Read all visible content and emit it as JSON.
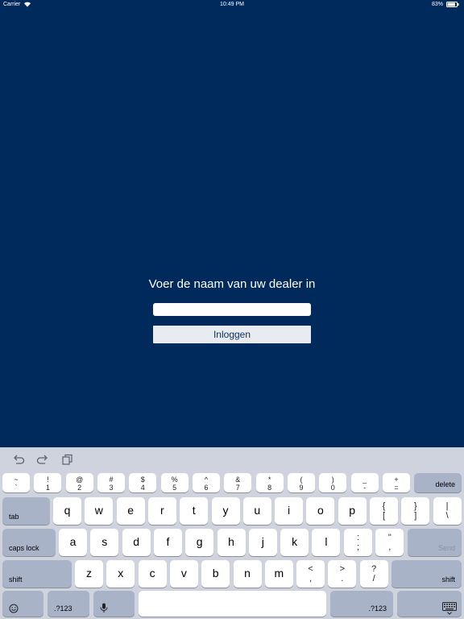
{
  "status_bar": {
    "carrier": "Carrier",
    "time": "10:49 PM",
    "battery": "83%"
  },
  "login": {
    "prompt": "Voer de naam van uw dealer in",
    "input_value": "",
    "button_label": "Inloggen"
  },
  "keyboard": {
    "number_row": [
      {
        "up": "~",
        "dn": "`"
      },
      {
        "up": "!",
        "dn": "1"
      },
      {
        "up": "@",
        "dn": "2"
      },
      {
        "up": "#",
        "dn": "3"
      },
      {
        "up": "$",
        "dn": "4"
      },
      {
        "up": "%",
        "dn": "5"
      },
      {
        "up": "^",
        "dn": "6"
      },
      {
        "up": "&",
        "dn": "7"
      },
      {
        "up": "*",
        "dn": "8"
      },
      {
        "up": "(",
        "dn": "9"
      },
      {
        "up": ")",
        "dn": "0"
      },
      {
        "up": "_",
        "dn": "-"
      },
      {
        "up": "+",
        "dn": "="
      }
    ],
    "delete": "delete",
    "tab": "tab",
    "row1": [
      "q",
      "w",
      "e",
      "r",
      "t",
      "y",
      "u",
      "i",
      "o",
      "p"
    ],
    "row1_sym": [
      {
        "up": "{",
        "dn": "["
      },
      {
        "up": "}",
        "dn": "]"
      },
      {
        "up": "|",
        "dn": "\\"
      }
    ],
    "caps_lock": "caps lock",
    "row2": [
      "a",
      "s",
      "d",
      "f",
      "g",
      "h",
      "j",
      "k",
      "l"
    ],
    "row2_sym": [
      {
        "up": ":",
        "dn": ";"
      },
      {
        "up": "\"",
        "dn": ","
      }
    ],
    "send": "Send",
    "shift_left": "shift",
    "row3": [
      "z",
      "x",
      "c",
      "v",
      "b",
      "n",
      "m"
    ],
    "row3_sym": [
      {
        "up": "<",
        "dn": ","
      },
      {
        "up": ">",
        "dn": "."
      },
      {
        "up": "?",
        "dn": "/"
      }
    ],
    "shift_right": "shift",
    "num_toggle_left": ".?123",
    "num_toggle_right": ".?123",
    "icons": {
      "undo": "undo-icon",
      "redo": "redo-icon",
      "paste": "paste-icon",
      "emoji": "emoji-icon",
      "mic": "microphone-icon",
      "hide_keyboard": "keyboard-dismiss-icon"
    }
  }
}
